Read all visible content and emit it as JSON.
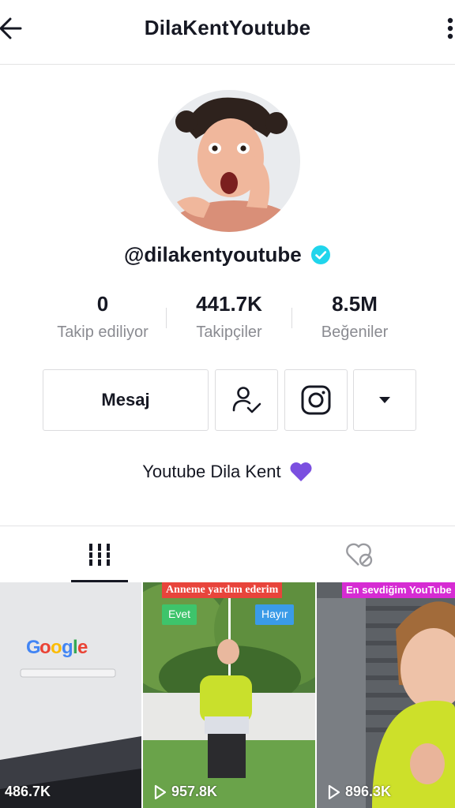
{
  "header": {
    "title": "DilaKentYoutube"
  },
  "profile": {
    "username": "@dilakentyoutube",
    "verified_color": "#20d5ec",
    "bio": "Youtube Dila Kent",
    "bio_emoji": "purple-heart"
  },
  "stats": [
    {
      "value": "0",
      "label": "Takip ediliyor"
    },
    {
      "value": "441.7K",
      "label": "Takipçiler"
    },
    {
      "value": "8.5M",
      "label": "Beğeniler"
    }
  ],
  "actions": {
    "message_label": "Mesaj",
    "icons": [
      "following-check-icon",
      "instagram-icon",
      "caret-down-icon"
    ]
  },
  "tabs": {
    "icons": [
      "grid-icon",
      "liked-hidden-icon"
    ],
    "active_color": "#161823"
  },
  "videos": [
    {
      "views": "486.7K",
      "caption": "",
      "thumb_text": "Google"
    },
    {
      "views": "957.8K",
      "caption": "Anneme yardım ederim",
      "tag_left": "Evet",
      "tag_right": "Hayır"
    },
    {
      "views": "896.3K",
      "caption": "En sevdiğim YouTube"
    }
  ],
  "colors": {
    "caption_red": "#e8443b",
    "caption_magenta": "#d62bd3",
    "tag_green": "#3ec46b",
    "tag_blue": "#3a9be8",
    "heart_purple": "#7b4fe0"
  }
}
